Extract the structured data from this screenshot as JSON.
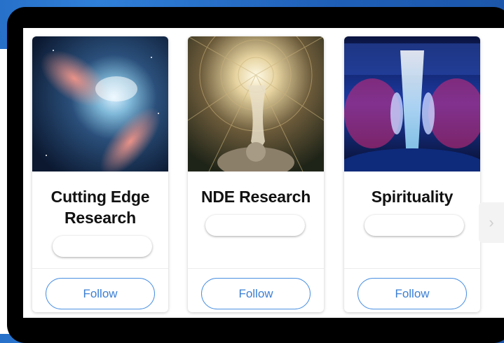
{
  "carousel": {
    "cards": [
      {
        "title": "Cutting Edge Research",
        "image": "nebula-image",
        "follow_label": "Follow"
      },
      {
        "title": "NDE Research",
        "image": "visionary-tunnel-image",
        "follow_label": "Follow"
      },
      {
        "title": "Spirituality",
        "image": "cosmic-figures-image",
        "follow_label": "Follow"
      }
    ],
    "next_icon": "chevron-right-icon",
    "next_glyph": "›"
  },
  "colors": {
    "accent": "#4a90e2",
    "follow_text": "#3b7fd4",
    "background": "#1f5fb8",
    "frame": "#000000"
  }
}
